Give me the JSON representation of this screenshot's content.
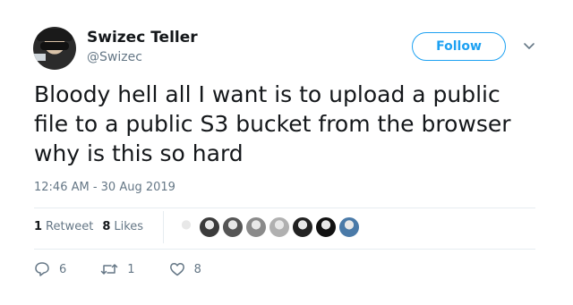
{
  "author": {
    "name": "Swizec Teller",
    "handle": "@Swizec",
    "avatar_icon": "profile-photo"
  },
  "follow_button": {
    "label": "Follow"
  },
  "menu": {
    "icon": "chevron-down-icon"
  },
  "tweet": {
    "text": "Bloody hell all I want is to upload a public file to a public S3 bucket from the browser why is this so hard",
    "timestamp": "12:46 AM - 30 Aug 2019"
  },
  "stats": {
    "retweets_count": "1",
    "retweets_label": "Retweet",
    "likes_count": "8",
    "likes_label": "Likes"
  },
  "likers": [
    {
      "icon": "avatar-icon",
      "color": "#ffffff"
    },
    {
      "icon": "avatar-icon",
      "color": "#3b3b3b"
    },
    {
      "icon": "avatar-icon",
      "color": "#555555"
    },
    {
      "icon": "avatar-icon",
      "color": "#8a8a8a"
    },
    {
      "icon": "avatar-icon",
      "color": "#b0b0b0"
    },
    {
      "icon": "avatar-icon",
      "color": "#222222"
    },
    {
      "icon": "avatar-icon",
      "color": "#111111"
    },
    {
      "icon": "avatar-icon",
      "color": "#4a7aa8"
    }
  ],
  "actions": {
    "reply_count": "6",
    "retweet_count": "1",
    "like_count": "8"
  },
  "colors": {
    "accent": "#1da1f2",
    "muted": "#657786",
    "text": "#14171a",
    "divider": "#e6ecf0"
  }
}
